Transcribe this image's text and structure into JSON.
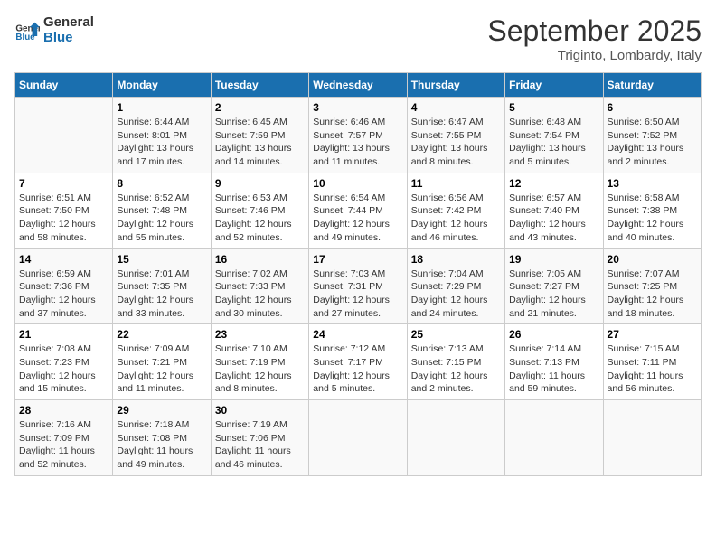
{
  "header": {
    "logo_line1": "General",
    "logo_line2": "Blue",
    "month": "September 2025",
    "location": "Triginto, Lombardy, Italy"
  },
  "days_of_week": [
    "Sunday",
    "Monday",
    "Tuesday",
    "Wednesday",
    "Thursday",
    "Friday",
    "Saturday"
  ],
  "weeks": [
    [
      {
        "day": "",
        "info": ""
      },
      {
        "day": "1",
        "info": "Sunrise: 6:44 AM\nSunset: 8:01 PM\nDaylight: 13 hours\nand 17 minutes."
      },
      {
        "day": "2",
        "info": "Sunrise: 6:45 AM\nSunset: 7:59 PM\nDaylight: 13 hours\nand 14 minutes."
      },
      {
        "day": "3",
        "info": "Sunrise: 6:46 AM\nSunset: 7:57 PM\nDaylight: 13 hours\nand 11 minutes."
      },
      {
        "day": "4",
        "info": "Sunrise: 6:47 AM\nSunset: 7:55 PM\nDaylight: 13 hours\nand 8 minutes."
      },
      {
        "day": "5",
        "info": "Sunrise: 6:48 AM\nSunset: 7:54 PM\nDaylight: 13 hours\nand 5 minutes."
      },
      {
        "day": "6",
        "info": "Sunrise: 6:50 AM\nSunset: 7:52 PM\nDaylight: 13 hours\nand 2 minutes."
      }
    ],
    [
      {
        "day": "7",
        "info": "Sunrise: 6:51 AM\nSunset: 7:50 PM\nDaylight: 12 hours\nand 58 minutes."
      },
      {
        "day": "8",
        "info": "Sunrise: 6:52 AM\nSunset: 7:48 PM\nDaylight: 12 hours\nand 55 minutes."
      },
      {
        "day": "9",
        "info": "Sunrise: 6:53 AM\nSunset: 7:46 PM\nDaylight: 12 hours\nand 52 minutes."
      },
      {
        "day": "10",
        "info": "Sunrise: 6:54 AM\nSunset: 7:44 PM\nDaylight: 12 hours\nand 49 minutes."
      },
      {
        "day": "11",
        "info": "Sunrise: 6:56 AM\nSunset: 7:42 PM\nDaylight: 12 hours\nand 46 minutes."
      },
      {
        "day": "12",
        "info": "Sunrise: 6:57 AM\nSunset: 7:40 PM\nDaylight: 12 hours\nand 43 minutes."
      },
      {
        "day": "13",
        "info": "Sunrise: 6:58 AM\nSunset: 7:38 PM\nDaylight: 12 hours\nand 40 minutes."
      }
    ],
    [
      {
        "day": "14",
        "info": "Sunrise: 6:59 AM\nSunset: 7:36 PM\nDaylight: 12 hours\nand 37 minutes."
      },
      {
        "day": "15",
        "info": "Sunrise: 7:01 AM\nSunset: 7:35 PM\nDaylight: 12 hours\nand 33 minutes."
      },
      {
        "day": "16",
        "info": "Sunrise: 7:02 AM\nSunset: 7:33 PM\nDaylight: 12 hours\nand 30 minutes."
      },
      {
        "day": "17",
        "info": "Sunrise: 7:03 AM\nSunset: 7:31 PM\nDaylight: 12 hours\nand 27 minutes."
      },
      {
        "day": "18",
        "info": "Sunrise: 7:04 AM\nSunset: 7:29 PM\nDaylight: 12 hours\nand 24 minutes."
      },
      {
        "day": "19",
        "info": "Sunrise: 7:05 AM\nSunset: 7:27 PM\nDaylight: 12 hours\nand 21 minutes."
      },
      {
        "day": "20",
        "info": "Sunrise: 7:07 AM\nSunset: 7:25 PM\nDaylight: 12 hours\nand 18 minutes."
      }
    ],
    [
      {
        "day": "21",
        "info": "Sunrise: 7:08 AM\nSunset: 7:23 PM\nDaylight: 12 hours\nand 15 minutes."
      },
      {
        "day": "22",
        "info": "Sunrise: 7:09 AM\nSunset: 7:21 PM\nDaylight: 12 hours\nand 11 minutes."
      },
      {
        "day": "23",
        "info": "Sunrise: 7:10 AM\nSunset: 7:19 PM\nDaylight: 12 hours\nand 8 minutes."
      },
      {
        "day": "24",
        "info": "Sunrise: 7:12 AM\nSunset: 7:17 PM\nDaylight: 12 hours\nand 5 minutes."
      },
      {
        "day": "25",
        "info": "Sunrise: 7:13 AM\nSunset: 7:15 PM\nDaylight: 12 hours\nand 2 minutes."
      },
      {
        "day": "26",
        "info": "Sunrise: 7:14 AM\nSunset: 7:13 PM\nDaylight: 11 hours\nand 59 minutes."
      },
      {
        "day": "27",
        "info": "Sunrise: 7:15 AM\nSunset: 7:11 PM\nDaylight: 11 hours\nand 56 minutes."
      }
    ],
    [
      {
        "day": "28",
        "info": "Sunrise: 7:16 AM\nSunset: 7:09 PM\nDaylight: 11 hours\nand 52 minutes."
      },
      {
        "day": "29",
        "info": "Sunrise: 7:18 AM\nSunset: 7:08 PM\nDaylight: 11 hours\nand 49 minutes."
      },
      {
        "day": "30",
        "info": "Sunrise: 7:19 AM\nSunset: 7:06 PM\nDaylight: 11 hours\nand 46 minutes."
      },
      {
        "day": "",
        "info": ""
      },
      {
        "day": "",
        "info": ""
      },
      {
        "day": "",
        "info": ""
      },
      {
        "day": "",
        "info": ""
      }
    ]
  ]
}
